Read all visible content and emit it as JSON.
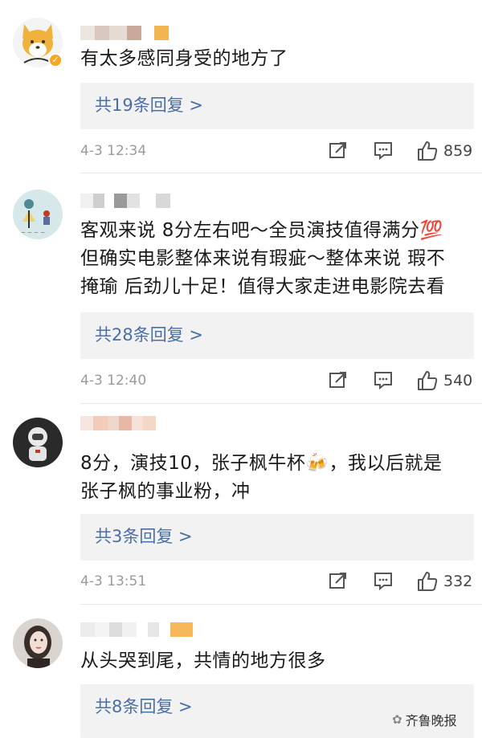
{
  "comments": [
    {
      "text": "有太多感同身受的地方了",
      "reply_label": "共19条回复 >",
      "date": "4-3 12:34",
      "likes": "859",
      "avatar": "corgi-avatar",
      "verified": true
    },
    {
      "text_lines": [
        "客观来说 8分左右吧～全员演技值得满分💯",
        "但确实电影整体来说有瑕疵～整体来说 瑕不",
        "掩瑜 后劲儿十足！值得大家走进电影院去看"
      ],
      "reply_label": "共28条回复 >",
      "date": "4-3 12:40",
      "likes": "540",
      "avatar": "drawing-avatar"
    },
    {
      "text_lines": [
        "8分，演技10，张子枫牛杯🍻，我以后就是",
        "张子枫的事业粉，冲"
      ],
      "reply_label": "共3条回复 >",
      "date": "4-3 13:51",
      "likes": "332",
      "avatar": "astronaut-avatar"
    },
    {
      "text": "从头哭到尾，共情的地方很多",
      "reply_label": "共8条回复 >",
      "avatar": "woman-portrait-avatar"
    }
  ],
  "icons": {
    "share": "share-icon",
    "comment": "comment-icon",
    "like": "thumbs-up-icon"
  },
  "watermark": {
    "text": "齐鲁晚报",
    "icon": "wechat-icon"
  },
  "colors": {
    "link": "#4a6fa5",
    "reply_bg": "#f2f2f2",
    "meta": "#9a9a9a",
    "badge": "#f5a623"
  }
}
